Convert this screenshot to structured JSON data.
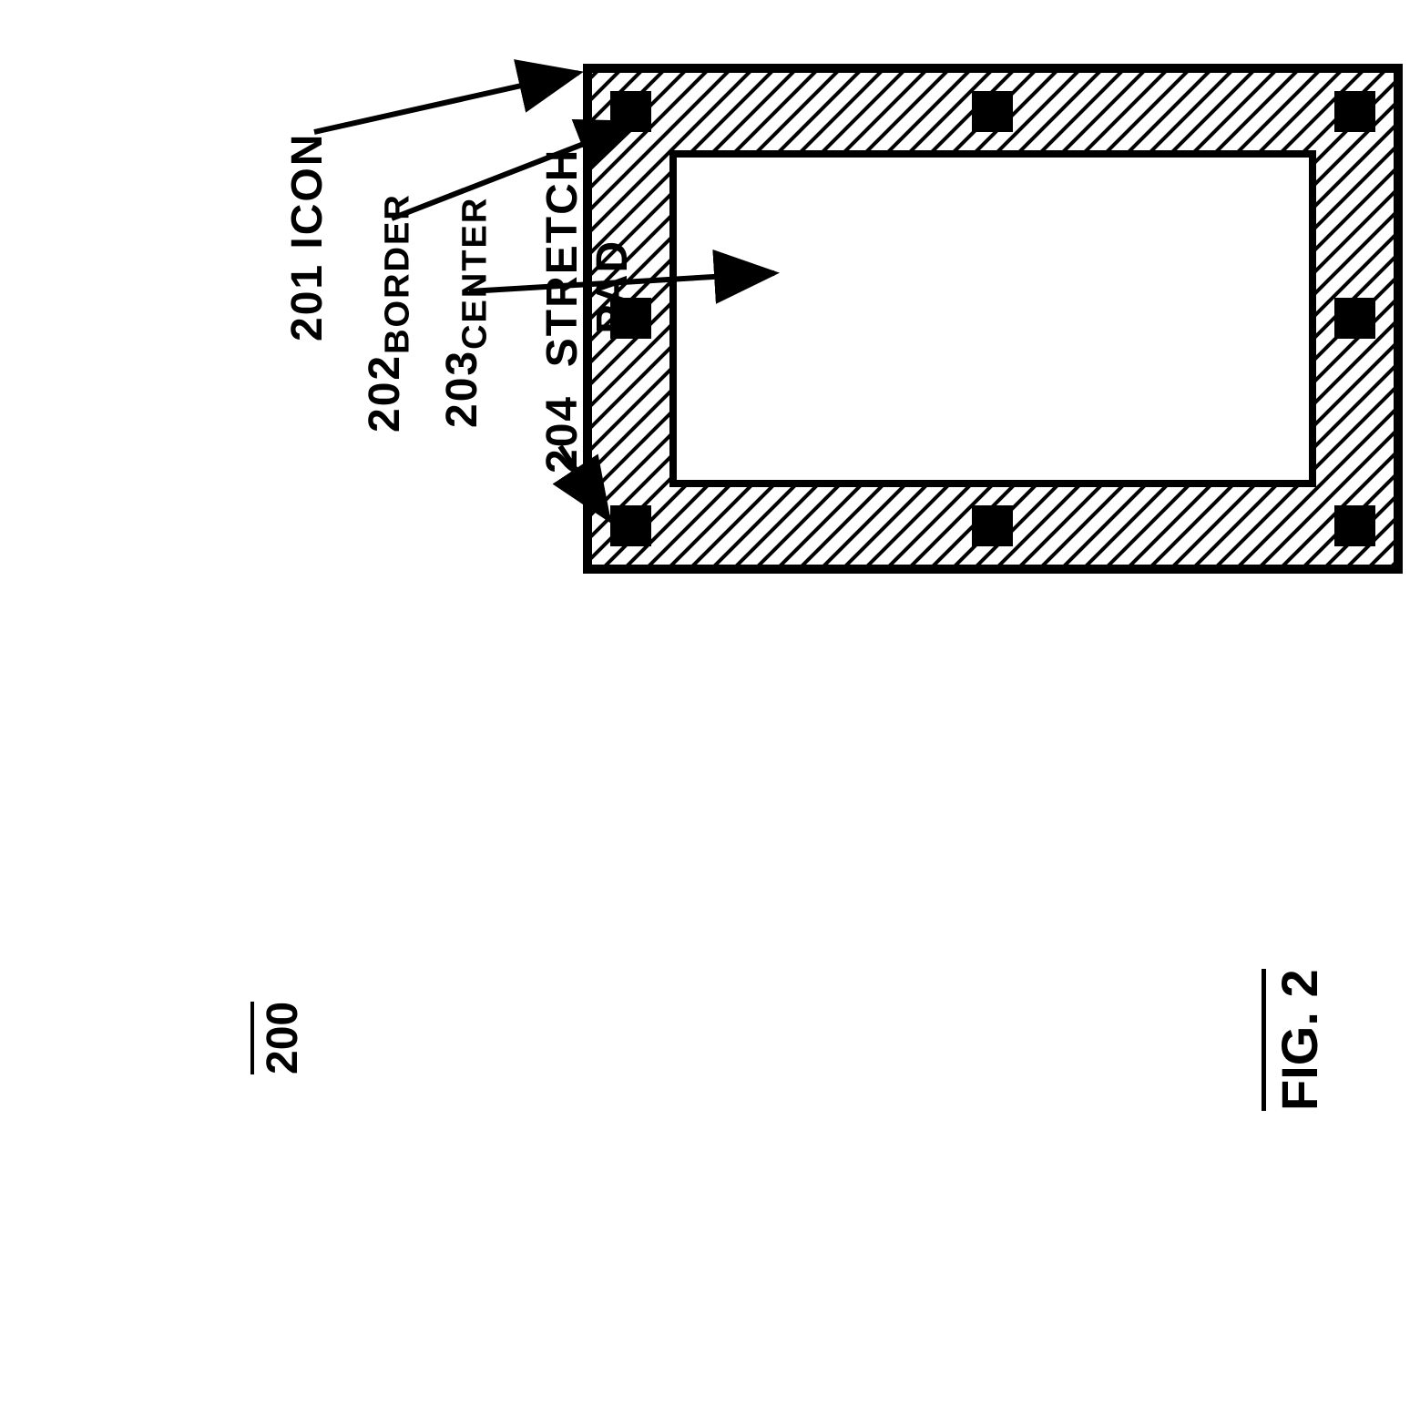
{
  "labels": {
    "icon": "201 ICON",
    "border": "202 BORDER",
    "center": "203 CENTER",
    "stretch_pad": "204  STRETCH\n          PAD",
    "ref": "200",
    "figure": "FIG. 2"
  },
  "diagram": {
    "reference_numbers": {
      "icon": "201",
      "border": "202",
      "center": "203",
      "stretch_pad": "204",
      "overall": "200"
    },
    "parts": [
      {
        "ref": "201",
        "name": "ICON"
      },
      {
        "ref": "202",
        "name": "BORDER"
      },
      {
        "ref": "203",
        "name": "CENTER"
      },
      {
        "ref": "204",
        "name": "STRETCH PAD"
      }
    ],
    "figure_number": "2",
    "pad_count": 8
  }
}
